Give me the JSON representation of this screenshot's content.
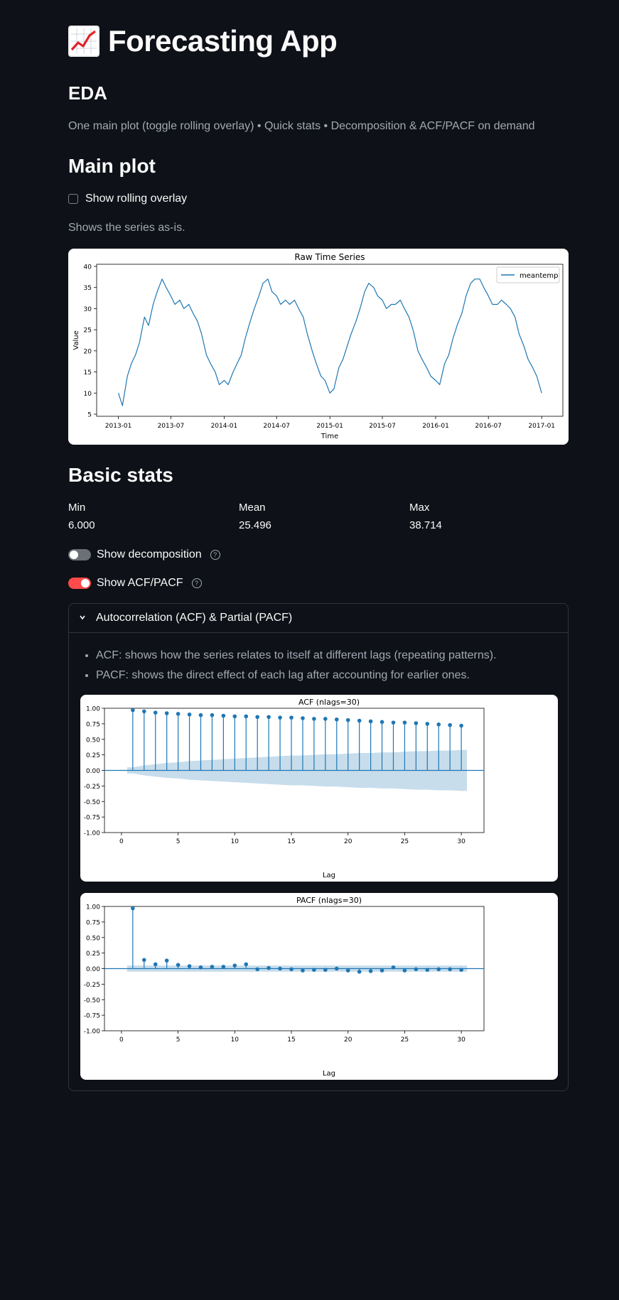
{
  "app_title": "Forecasting App",
  "eda": {
    "heading": "EDA",
    "caption": "One main plot (toggle rolling overlay) • Quick stats • Decomposition & ACF/PACF on demand"
  },
  "main_plot": {
    "heading": "Main plot",
    "rolling_label": "Show rolling overlay",
    "rolling_checked": false,
    "series_caption": "Shows the series as-is."
  },
  "basic_stats": {
    "heading": "Basic stats",
    "items": [
      {
        "label": "Min",
        "value": "6.000"
      },
      {
        "label": "Mean",
        "value": "25.496"
      },
      {
        "label": "Max",
        "value": "38.714"
      }
    ]
  },
  "toggles": {
    "decomposition_label": "Show decomposition",
    "decomposition_on": false,
    "acf_label": "Show ACF/PACF",
    "acf_on": true
  },
  "expander": {
    "title": "Autocorrelation (ACF) & Partial (PACF)",
    "bullets": [
      "ACF: shows how the series relates to itself at different lags (repeating patterns).",
      "PACF: shows the direct effect of each lag after accounting for earlier ones."
    ]
  },
  "colors": {
    "accent": "#ff4b4b",
    "series": "#1f77b4",
    "background": "#0e1117"
  },
  "chart_data": [
    {
      "type": "line",
      "title": "Raw Time Series",
      "xlabel": "Time",
      "ylabel": "Value",
      "xlim": [
        "2012-10-18",
        "2017-03-15"
      ],
      "ylim": [
        4.5,
        40.5
      ],
      "yticks": [
        5,
        10,
        15,
        20,
        25,
        30,
        35,
        40
      ],
      "xticks": [
        "2013-01",
        "2013-07",
        "2014-01",
        "2014-07",
        "2015-01",
        "2015-07",
        "2016-01",
        "2016-07",
        "2017-01"
      ],
      "legend": "top-right",
      "series": [
        {
          "name": "meantemp",
          "x": [
            "2013-01-01",
            "2013-01-15",
            "2013-02-01",
            "2013-02-15",
            "2013-03-01",
            "2013-03-15",
            "2013-04-01",
            "2013-04-15",
            "2013-05-01",
            "2013-05-15",
            "2013-06-01",
            "2013-06-15",
            "2013-07-01",
            "2013-07-15",
            "2013-08-01",
            "2013-08-15",
            "2013-09-01",
            "2013-09-15",
            "2013-10-01",
            "2013-10-15",
            "2013-11-01",
            "2013-11-15",
            "2013-12-01",
            "2013-12-15",
            "2014-01-01",
            "2014-01-15",
            "2014-02-01",
            "2014-02-15",
            "2014-03-01",
            "2014-03-15",
            "2014-04-01",
            "2014-04-15",
            "2014-05-01",
            "2014-05-15",
            "2014-06-01",
            "2014-06-15",
            "2014-07-01",
            "2014-07-15",
            "2014-08-01",
            "2014-08-15",
            "2014-09-01",
            "2014-09-15",
            "2014-10-01",
            "2014-10-15",
            "2014-11-01",
            "2014-11-15",
            "2014-12-01",
            "2014-12-15",
            "2015-01-01",
            "2015-01-15",
            "2015-02-01",
            "2015-02-15",
            "2015-03-01",
            "2015-03-15",
            "2015-04-01",
            "2015-04-15",
            "2015-05-01",
            "2015-05-15",
            "2015-06-01",
            "2015-06-15",
            "2015-07-01",
            "2015-07-15",
            "2015-08-01",
            "2015-08-15",
            "2015-09-01",
            "2015-09-15",
            "2015-10-01",
            "2015-10-15",
            "2015-11-01",
            "2015-11-15",
            "2015-12-01",
            "2015-12-15",
            "2016-01-01",
            "2016-01-15",
            "2016-02-01",
            "2016-02-15",
            "2016-03-01",
            "2016-03-15",
            "2016-04-01",
            "2016-04-15",
            "2016-05-01",
            "2016-05-15",
            "2016-06-01",
            "2016-06-15",
            "2016-07-01",
            "2016-07-15",
            "2016-08-01",
            "2016-08-15",
            "2016-09-01",
            "2016-09-15",
            "2016-10-01",
            "2016-10-15",
            "2016-11-01",
            "2016-11-15",
            "2016-12-01",
            "2016-12-15",
            "2017-01-01"
          ],
          "values": [
            10,
            7,
            14,
            17,
            19,
            22,
            28,
            26,
            31,
            34,
            37,
            35,
            33,
            31,
            32,
            30,
            31,
            29,
            27,
            24,
            19,
            17,
            15,
            12,
            13,
            12,
            15,
            17,
            19,
            23,
            27,
            30,
            33,
            36,
            37,
            34,
            33,
            31,
            32,
            31,
            32,
            30,
            28,
            24,
            20,
            17,
            14,
            13,
            10,
            11,
            16,
            18,
            21,
            24,
            27,
            30,
            34,
            36,
            35,
            33,
            32,
            30,
            31,
            31,
            32,
            30,
            28,
            25,
            20,
            18,
            16,
            14,
            13,
            12,
            17,
            19,
            23,
            26,
            29,
            33,
            36,
            37,
            37,
            35,
            33,
            31,
            31,
            32,
            31,
            30,
            28,
            24,
            21,
            18,
            16,
            14,
            10
          ]
        }
      ]
    },
    {
      "type": "stem",
      "title": "ACF (nlags=30)",
      "xlabel": "Lag",
      "xlim": [
        -1.5,
        32
      ],
      "ylim": [
        -1.0,
        1.0
      ],
      "xticks": [
        0,
        5,
        10,
        15,
        20,
        25,
        30
      ],
      "yticks": [
        1.0,
        0.75,
        0.5,
        0.25,
        0.0,
        -0.25,
        -0.5,
        -0.75,
        -1.0
      ],
      "lags": [
        1,
        2,
        3,
        4,
        5,
        6,
        7,
        8,
        9,
        10,
        11,
        12,
        13,
        14,
        15,
        16,
        17,
        18,
        19,
        20,
        21,
        22,
        23,
        24,
        25,
        26,
        27,
        28,
        29,
        30
      ],
      "values": [
        0.97,
        0.95,
        0.93,
        0.92,
        0.91,
        0.9,
        0.89,
        0.89,
        0.88,
        0.87,
        0.87,
        0.86,
        0.86,
        0.85,
        0.85,
        0.84,
        0.83,
        0.83,
        0.82,
        0.81,
        0.8,
        0.79,
        0.78,
        0.77,
        0.77,
        0.76,
        0.75,
        0.74,
        0.73,
        0.72
      ],
      "confidence_band": [
        0.05,
        0.08,
        0.1,
        0.12,
        0.13,
        0.15,
        0.16,
        0.17,
        0.18,
        0.19,
        0.2,
        0.21,
        0.22,
        0.23,
        0.24,
        0.24,
        0.25,
        0.26,
        0.26,
        0.27,
        0.28,
        0.28,
        0.29,
        0.29,
        0.3,
        0.31,
        0.31,
        0.32,
        0.32,
        0.33
      ]
    },
    {
      "type": "stem",
      "title": "PACF (nlags=30)",
      "xlabel": "Lag",
      "xlim": [
        -1.5,
        32
      ],
      "ylim": [
        -1.0,
        1.0
      ],
      "xticks": [
        0,
        5,
        10,
        15,
        20,
        25,
        30
      ],
      "yticks": [
        1.0,
        0.75,
        0.5,
        0.25,
        0.0,
        -0.25,
        -0.5,
        -0.75,
        -1.0
      ],
      "lags": [
        1,
        2,
        3,
        4,
        5,
        6,
        7,
        8,
        9,
        10,
        11,
        12,
        13,
        14,
        15,
        16,
        17,
        18,
        19,
        20,
        21,
        22,
        23,
        24,
        25,
        26,
        27,
        28,
        29,
        30
      ],
      "values": [
        0.97,
        0.14,
        0.07,
        0.13,
        0.06,
        0.04,
        0.02,
        0.03,
        0.03,
        0.05,
        0.07,
        -0.01,
        0.01,
        0.0,
        -0.01,
        -0.03,
        -0.02,
        -0.02,
        0.0,
        -0.03,
        -0.05,
        -0.04,
        -0.03,
        0.02,
        -0.03,
        -0.01,
        -0.02,
        -0.01,
        -0.01,
        -0.02
      ],
      "confidence_band": [
        0.05,
        0.05,
        0.05,
        0.05,
        0.05,
        0.05,
        0.05,
        0.05,
        0.05,
        0.05,
        0.05,
        0.05,
        0.05,
        0.05,
        0.05,
        0.05,
        0.05,
        0.05,
        0.05,
        0.05,
        0.05,
        0.05,
        0.05,
        0.05,
        0.05,
        0.05,
        0.05,
        0.05,
        0.05,
        0.05
      ]
    }
  ]
}
